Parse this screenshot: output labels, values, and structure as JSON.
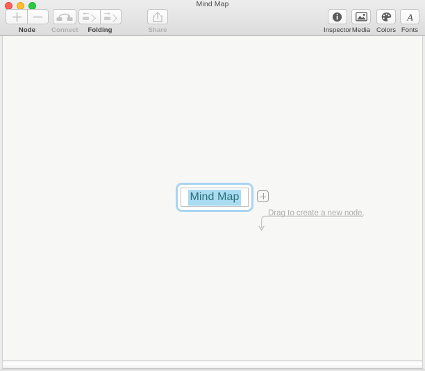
{
  "window": {
    "title": "Mind Map",
    "traffic_lights": [
      {
        "name": "close",
        "color": "#ff6159"
      },
      {
        "name": "minimize",
        "color": "#ffbd2e"
      },
      {
        "name": "zoom",
        "color": "#2bca42"
      }
    ]
  },
  "toolbar": {
    "groups": [
      {
        "label": "Node",
        "enabled": true,
        "buttons": [
          {
            "name": "add-node",
            "icon": "plus-icon",
            "enabled": true
          },
          {
            "name": "remove-node",
            "icon": "minus-icon",
            "enabled": false
          }
        ]
      },
      {
        "label": "Connect",
        "enabled": false,
        "buttons": [
          {
            "name": "connect-nodes",
            "icon": "connect-arc-icon",
            "enabled": false
          }
        ]
      },
      {
        "label": "Folding",
        "enabled": true,
        "buttons": [
          {
            "name": "fold-node",
            "icon": "fold-left-icon",
            "enabled": false
          },
          {
            "name": "unfold-node",
            "icon": "unfold-right-icon",
            "enabled": false
          }
        ]
      },
      {
        "label": "Share",
        "enabled": false,
        "buttons": [
          {
            "name": "share",
            "icon": "share-icon",
            "enabled": false
          }
        ]
      }
    ],
    "right_items": [
      {
        "label": "Inspector",
        "icon": "info-circle-icon"
      },
      {
        "label": "Media",
        "icon": "media-image-icon"
      },
      {
        "label": "Colors",
        "icon": "color-palette-icon"
      },
      {
        "label": "Fonts",
        "icon": "font-a-icon"
      }
    ]
  },
  "canvas": {
    "node": {
      "text": "Mind Map",
      "text_selected": true,
      "editing": true,
      "selection_color": "#a9dcf0",
      "text_color": "#2d6e78",
      "focus_ring_color": "#a8d4f2"
    },
    "drag_handle": {
      "name": "create-node-handle",
      "icon": "plus-in-rounded-square-icon"
    },
    "hint": {
      "text": "Drag to create a new node.",
      "color": "#aeaeae"
    }
  }
}
